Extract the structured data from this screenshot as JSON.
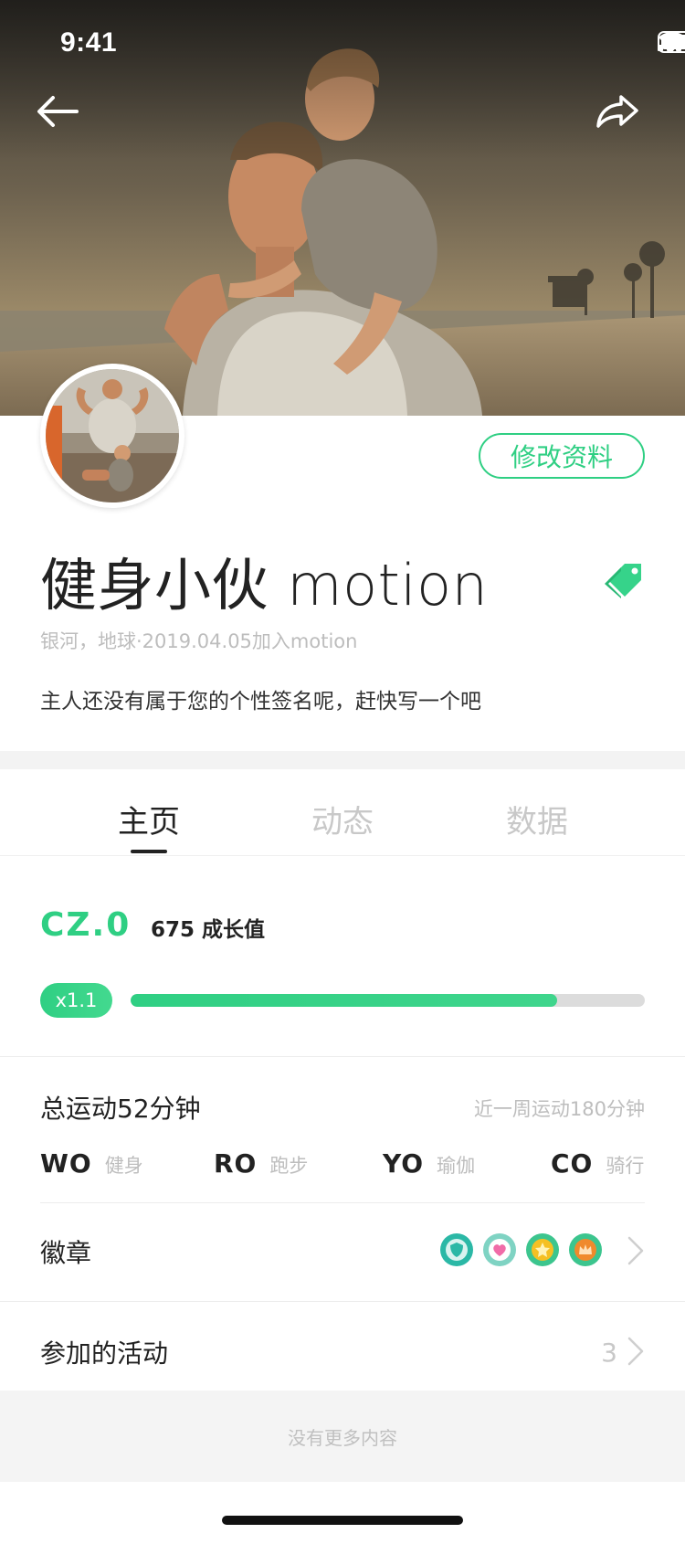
{
  "status_bar": {
    "time": "9:41"
  },
  "profile": {
    "name": "健身小伙 motion",
    "meta": "银河，地球·2019.04.05加入motion",
    "bio": "主人还没有属于您的个性签名呢，赶快写一个吧",
    "edit_label": "修改资料"
  },
  "tabs": [
    {
      "label": "主页",
      "active": true
    },
    {
      "label": "动态",
      "active": false
    },
    {
      "label": "数据",
      "active": false
    }
  ],
  "growth": {
    "level": "CZ.0",
    "points_text": "675 成长值",
    "multiplier": "x1.1",
    "progress": 0.83
  },
  "exercise": {
    "total": "总运动52分钟",
    "week": "近一周运动180分钟",
    "sports": [
      {
        "code": "WO",
        "name": "健身"
      },
      {
        "code": "RO",
        "name": "跑步"
      },
      {
        "code": "YO",
        "name": "瑜伽"
      },
      {
        "code": "CO",
        "name": "骑行"
      }
    ]
  },
  "badges": {
    "label": "徽章",
    "items": [
      {
        "icon": "shield-medal-icon",
        "color": "#2bb8a6"
      },
      {
        "icon": "heart-medal-icon",
        "color": "#f06ca8"
      },
      {
        "icon": "star-medal-icon",
        "color": "#f5c023"
      },
      {
        "icon": "crown-medal-icon",
        "color": "#f08a2c"
      }
    ]
  },
  "activities": {
    "label": "参加的活动",
    "count": "3"
  },
  "footer": {
    "text": "没有更多内容"
  },
  "colors": {
    "accent": "#2fcf83",
    "muted": "#bdbdbd"
  }
}
